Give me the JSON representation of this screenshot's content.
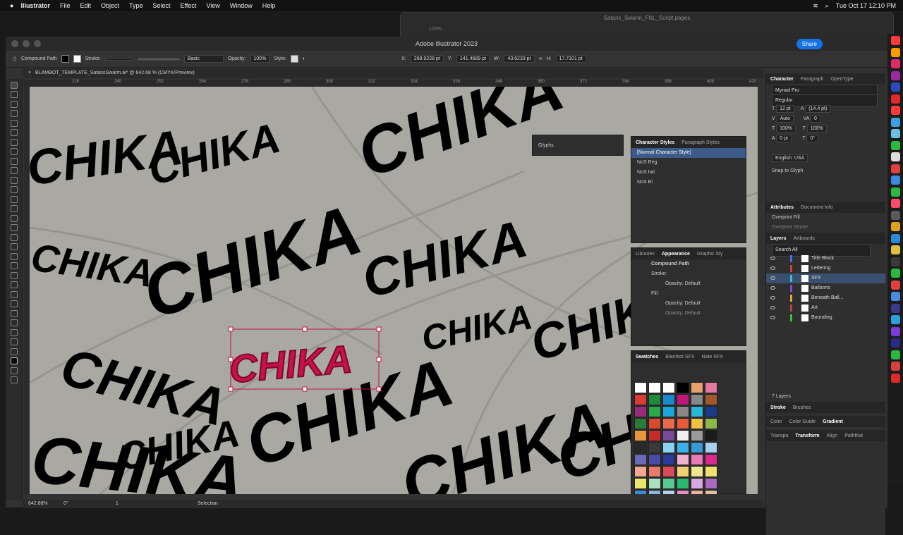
{
  "menubar": {
    "app": "Illustrator",
    "items": [
      "File",
      "Edit",
      "Object",
      "Type",
      "Select",
      "Effect",
      "View",
      "Window",
      "Help"
    ],
    "datetime": "Tue Oct 17  12:10 PM"
  },
  "bg_window": {
    "title": "Satans_Swarm_FNL_Script.pages",
    "zoom": "125%"
  },
  "window": {
    "title": "Adobe Illustrator 2023",
    "share": "Share"
  },
  "control": {
    "selection": "Compound Path",
    "stroke": "Stroke:",
    "brush": "Basic",
    "opacity_label": "Opacity:",
    "opacity": "100%",
    "style": "Style:",
    "x_label": "X:",
    "x": "268.9228 pt",
    "y_label": "Y:",
    "y": "141.4689 pt",
    "w_label": "W:",
    "w": "43.6233 pt",
    "h_label": "H:",
    "h": "17.7101 pt"
  },
  "doc_tab": "BLAMBOT_TEMPLATE_SatansSwarm.ai* @ 642.68 % (CMYK/Preview)",
  "ruler": [
    "228",
    "240",
    "252",
    "264",
    "276",
    "288",
    "300",
    "312",
    "324",
    "336",
    "348",
    "360",
    "372",
    "384",
    "396",
    "408",
    "420"
  ],
  "canvas": {
    "word": "CHIKA"
  },
  "status": {
    "zoom": "642.68%",
    "angle": "0°",
    "artboard": "1",
    "tool": "Selection"
  },
  "glyphs": {
    "title": "Glyphs"
  },
  "char_styles": {
    "tabs": [
      "Character Styles",
      "Paragraph Styles"
    ],
    "items": [
      "[Normal Character Style]",
      "NoS Reg",
      "NoS Ital",
      "NoS BI"
    ]
  },
  "appearance": {
    "tabs": [
      "Libraries",
      "Appearance",
      "Graphic Sty"
    ],
    "title": "Compound Path",
    "stroke": "Stroke:",
    "opacity1": "Opacity: Default",
    "fill": "Fill:",
    "opacity2": "Opacity: Default",
    "opacity3": "Opacity: Default"
  },
  "swatches": {
    "tabs": [
      "Swatches",
      "Blambot SFX",
      "Nate SFX"
    ],
    "colors": [
      "#ffffff",
      "#ffffff",
      "#ffffff",
      "#000000",
      "#e8a06e",
      "#e07aa0",
      "#d93a32",
      "#1e8a3a",
      "#1a8acc",
      "#c0187a",
      "#888888",
      "#a05a2a",
      "#9a2a7a",
      "#2aa84a",
      "#1aa8d8",
      "#888888",
      "#2ab8d8",
      "#1a3a8a",
      "#2a7a3a",
      "#d84a2a",
      "#e86a4a",
      "#e85a3a",
      "#f0c040",
      "#8ab84a",
      "#e8983a",
      "#c82a2a",
      "#7a4a9a",
      "#f0f0f0",
      "#9a9a9a",
      "#1a1a1a",
      "#2a2a2a",
      "#3a3a3a",
      "#8ad0f0",
      "#3ab0e8",
      "#3a9ad8",
      "#a8d0f0",
      "#6a6ab8",
      "#4a4aa8",
      "#2a3a9a",
      "#f0b0d0",
      "#e87ab8",
      "#d82a8a",
      "#f0a890",
      "#e87a6a",
      "#d84a5a",
      "#f0d070",
      "#f0e890",
      "#f0e070",
      "#e8e86a",
      "#a8e0c0",
      "#5ac890",
      "#2ab870",
      "#d8a8e0",
      "#a86ac0",
      "#3a8ad8",
      "#8ab8e0",
      "#b8d0f0",
      "#e890c0",
      "#f0b0a0",
      "#e8c0a0",
      "#e87a8a",
      "#f0c070",
      "#d8b080",
      "#e8a060",
      "#c87a40",
      "#c06040"
    ]
  },
  "character": {
    "tabs": [
      "Character",
      "Paragraph",
      "OpenType"
    ],
    "font": "Myriad Pro",
    "style": "Regular",
    "size": "12 pt",
    "leading": "(14.4 pt)",
    "kerning": "Auto",
    "tracking": "0",
    "vscale": "100%",
    "hscale": "100%",
    "baseline": "0 pt",
    "rotate": "0°",
    "lang": "English: USA",
    "snap": "Snap to Glyph"
  },
  "attributes": {
    "tabs": [
      "Attributes",
      "Document Info"
    ],
    "overprint_fill": "Overprint Fill",
    "overprint_stroke": "Overprint Stroke"
  },
  "layers": {
    "tabs": [
      "Layers",
      "Artboards"
    ],
    "search": "Search All",
    "items": [
      {
        "name": "Title Block",
        "color": "#4a6af0"
      },
      {
        "name": "Lettering",
        "color": "#d04040"
      },
      {
        "name": "SFX",
        "color": "#3ab8e8"
      },
      {
        "name": "Balloons",
        "color": "#8a4ad8"
      },
      {
        "name": "Beneath Ball...",
        "color": "#e8a040"
      },
      {
        "name": "Art",
        "color": "#c04040"
      },
      {
        "name": "Bounding",
        "color": "#40c040"
      }
    ],
    "count": "7 Layers"
  },
  "bottom_tabs": [
    [
      "Stroke",
      "Brushes"
    ],
    [
      "Color",
      "Color Guide",
      "Gradient"
    ],
    [
      "Transpa",
      "Transform",
      "Align",
      "Pathfind"
    ]
  ],
  "colors": {
    "accent": "#1473e6",
    "selection": "#c8104a"
  }
}
